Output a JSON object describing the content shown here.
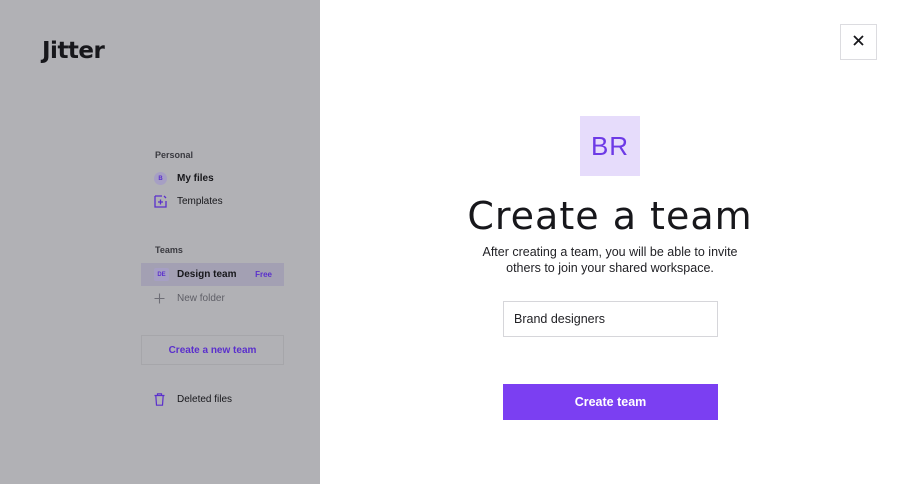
{
  "app": {
    "logo": "Jitter"
  },
  "sidebar": {
    "personal_label": "Personal",
    "personal_items": [
      {
        "label": "My files",
        "avatar": "B",
        "icon": "user-avatar"
      },
      {
        "label": "Templates",
        "icon": "template-icon"
      }
    ],
    "teams_label": "Teams",
    "team_items": [
      {
        "label": "Design team",
        "avatar": "DE",
        "badge": "Free",
        "active": true
      },
      {
        "label": "New folder",
        "icon": "plus-icon"
      }
    ],
    "create_team_label": "Create a new team",
    "deleted_label": "Deleted files",
    "deleted_icon": "trash-icon"
  },
  "modal": {
    "close_icon": "close-icon",
    "avatar_initials": "BR",
    "title": "Create a team",
    "description": "After creating a team, you will be able to invite others to join your shared workspace.",
    "input_value": "Brand designers",
    "submit_label": "Create team"
  },
  "colors": {
    "accent": "#7b3ff2",
    "accent_text": "#5a2fcc",
    "avatar_bg": "#e6dcfb",
    "overlay": "#b1b1b5"
  }
}
